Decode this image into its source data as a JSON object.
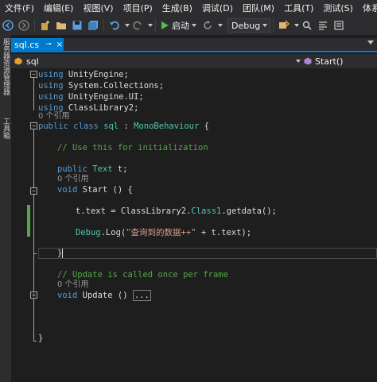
{
  "menu": [
    "文件(F)",
    "编辑(E)",
    "视图(V)",
    "项目(P)",
    "生成(B)",
    "调试(D)",
    "团队(M)",
    "工具(T)",
    "测试(S)",
    "体系结"
  ],
  "toolbar": {
    "start_label": "启动",
    "config_value": "Debug"
  },
  "left_strip": {
    "tab1": "服务器资源管理器",
    "tab2": "工具箱"
  },
  "tab": {
    "label": "sql.cs",
    "pin_glyph": "⊸",
    "close_glyph": "×"
  },
  "navbar": {
    "left": "sql",
    "right": "Start()"
  },
  "code": {
    "using1_kw": "using",
    "using1": " UnityEngine;",
    "using2_kw": "using",
    "using2": " System.Collections;",
    "using3_kw": "using",
    "using3": " UnityEngine.UI;",
    "using4_kw": "using",
    "using4": " ClassLibrary2;",
    "ref_class": "0 个引用",
    "class_pub": "public",
    "class_cls": " class ",
    "class_name": "sql",
    "class_sep": " : ",
    "class_base": "MonoBehaviour",
    "class_brace": " {",
    "comment_init": "// Use this for initialization",
    "field_pub": "public",
    "field_type": " Text",
    "field_rest": " t;",
    "ref_start": "0 个引用",
    "start_void": "void",
    "start_rest": " Start () {",
    "assign_a": "t.text = ClassLibrary2.",
    "assign_cls": "Class1",
    "assign_b": ".getdata();",
    "debug_a": "Debug",
    "debug_b": ".Log(",
    "debug_str": "\"查询到的数据++\"",
    "debug_c": " + t.text);",
    "close_start": "}",
    "comment_update": "// Update is called once per frame",
    "ref_update": "0 个引用",
    "update_void": "void",
    "update_rest": " Update () ",
    "update_collapsed": "...",
    "close_class": "}"
  }
}
